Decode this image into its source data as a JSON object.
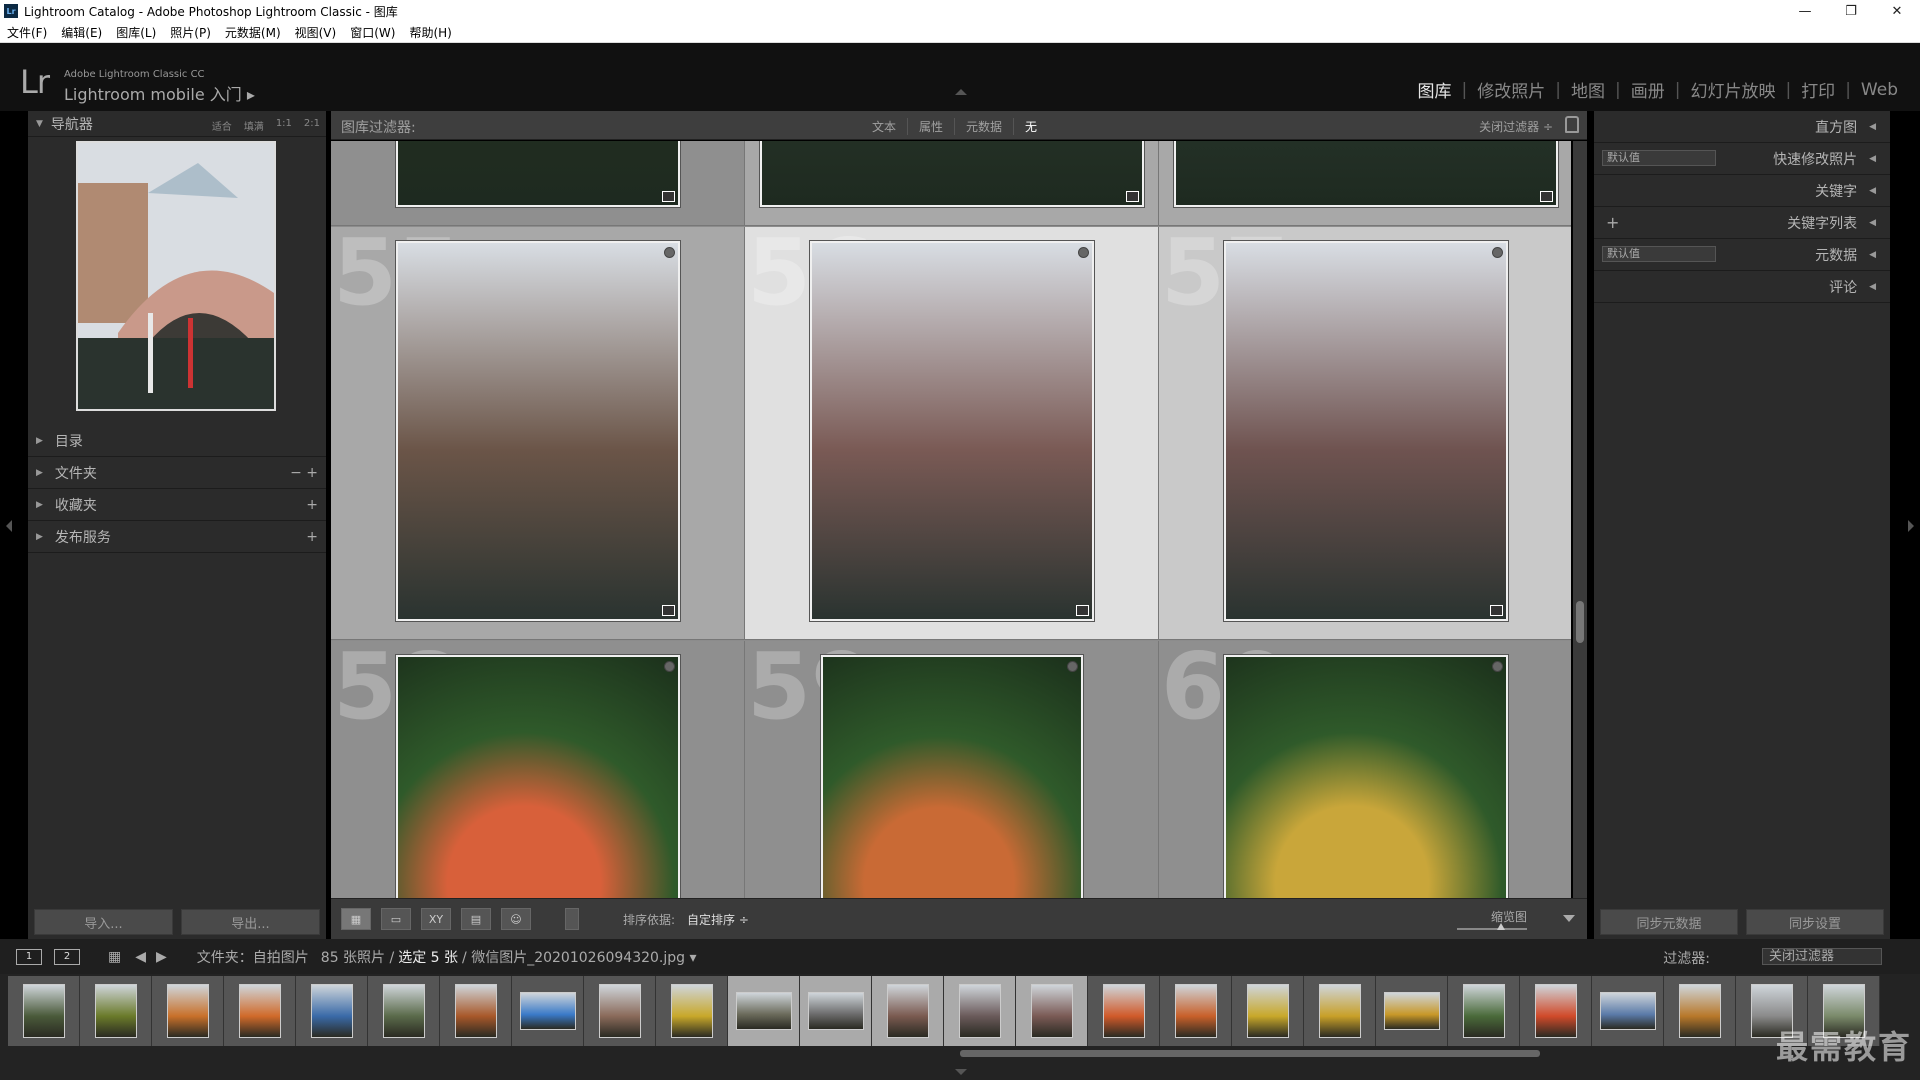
{
  "window": {
    "title": "Lightroom Catalog - Adobe Photoshop Lightroom Classic - 图库",
    "app_icon": "Lr",
    "controls": [
      "—",
      "❐",
      "✕"
    ]
  },
  "menu": [
    "文件(F)",
    "编辑(E)",
    "图库(L)",
    "照片(P)",
    "元数据(M)",
    "视图(V)",
    "窗口(W)",
    "帮助(H)"
  ],
  "identity": {
    "logo": "Lr",
    "product": "Adobe Lightroom Classic CC",
    "mobile": "Lightroom mobile 入门 ▸"
  },
  "modules": [
    {
      "label": "图库",
      "active": true
    },
    {
      "label": "修改照片"
    },
    {
      "label": "地图"
    },
    {
      "label": "画册"
    },
    {
      "label": "幻灯片放映"
    },
    {
      "label": "打印"
    },
    {
      "label": "Web"
    }
  ],
  "left": {
    "navigator": {
      "title": "导航器",
      "options": [
        "适合",
        "填满",
        "1:1",
        "2:1"
      ]
    },
    "panels": [
      {
        "label": "目录",
        "actions": ""
      },
      {
        "label": "文件夹",
        "actions": "− +"
      },
      {
        "label": "收藏夹",
        "actions": "+"
      },
      {
        "label": "发布服务",
        "actions": "+"
      }
    ],
    "import_label": "导入...",
    "export_label": "导出..."
  },
  "filter": {
    "label": "图库过滤器:",
    "tabs": [
      "文本",
      "属性",
      "元数据",
      "无"
    ],
    "right": "关闭过滤器 ÷"
  },
  "grid": {
    "cells": [
      {
        "idx": "",
        "state": "dark",
        "color": "#2c3a1e"
      },
      {
        "idx": "",
        "state": "normal",
        "color": "#3a4a3a"
      },
      {
        "idx": "",
        "state": "normal",
        "color": "#3d4e44"
      },
      {
        "idx": "55",
        "state": "normal",
        "color": "#6b5548"
      },
      {
        "idx": "56",
        "state": "sel-main",
        "color": "#7a5a55"
      },
      {
        "idx": "57",
        "state": "sel",
        "color": "#6f5350"
      },
      {
        "idx": "58",
        "state": "dark",
        "color": "#d8603a"
      },
      {
        "idx": "59",
        "state": "dark",
        "color": "#c96a35"
      },
      {
        "idx": "60",
        "state": "dark",
        "color": "#c9a63a"
      }
    ]
  },
  "toolbar": {
    "sort_label": "排序依据:",
    "sort_value": "自定排序 ÷",
    "zoom_label": "缩览图",
    "view_icons": [
      "▦",
      "▭",
      "XY",
      "▤",
      "☺"
    ]
  },
  "right": {
    "panels": [
      {
        "label": "直方图",
        "left": "",
        "select": ""
      },
      {
        "label": "快速修改照片",
        "left": "",
        "select": "默认值"
      },
      {
        "label": "关键字",
        "left": "",
        "select": ""
      },
      {
        "label": "关键字列表",
        "left": "+",
        "select": ""
      },
      {
        "label": "元数据",
        "left": "",
        "select": "默认值"
      },
      {
        "label": "评论",
        "left": "",
        "select": ""
      }
    ],
    "sync_meta": "同步元数据",
    "sync_settings": "同步设置"
  },
  "filmbar": {
    "screen1": "1",
    "screen2": "2",
    "path_prefix": "文件夹：自拍图片",
    "count": "85 张照片 /",
    "selected": "选定 5 张",
    "file": "/ 微信图片_20201026094320.jpg ▾",
    "filter_label": "过滤器:",
    "filter_value": "关闭过滤器"
  },
  "filmstrip": {
    "thumbs": [
      {
        "color": "#4a5a3a",
        "sel": false,
        "land": false
      },
      {
        "color": "#6a7a2a",
        "sel": false,
        "land": false
      },
      {
        "color": "#c8702a",
        "sel": false,
        "land": false
      },
      {
        "color": "#d06a2a",
        "sel": false,
        "land": false
      },
      {
        "color": "#3a6aa8",
        "sel": false,
        "land": false
      },
      {
        "color": "#5a6a4a",
        "sel": false,
        "land": false
      },
      {
        "color": "#a8582a",
        "sel": false,
        "land": false
      },
      {
        "color": "#3a7ac8",
        "sel": false,
        "land": true
      },
      {
        "color": "#8a6a5a",
        "sel": false,
        "land": false
      },
      {
        "color": "#c8a82a",
        "sel": false,
        "land": false
      },
      {
        "color": "#6a6a5a",
        "sel": true,
        "land": true
      },
      {
        "color": "#6a6a6a",
        "sel": true,
        "land": true
      },
      {
        "color": "#7a5a50",
        "sel": true,
        "land": false
      },
      {
        "color": "#6a5a5a",
        "sel": true,
        "land": false
      },
      {
        "color": "#7a5a55",
        "sel": true,
        "land": false
      },
      {
        "color": "#d05a2a",
        "sel": false,
        "land": false
      },
      {
        "color": "#c8602a",
        "sel": false,
        "land": false
      },
      {
        "color": "#c8a82a",
        "sel": false,
        "land": false
      },
      {
        "color": "#c8a028",
        "sel": false,
        "land": false
      },
      {
        "color": "#c89828",
        "sel": false,
        "land": true
      },
      {
        "color": "#4a6a3a",
        "sel": false,
        "land": false
      },
      {
        "color": "#d04a2a",
        "sel": false,
        "land": false
      },
      {
        "color": "#5a7aa8",
        "sel": false,
        "land": true
      },
      {
        "color": "#b8782a",
        "sel": false,
        "land": false
      },
      {
        "color": "#8a8a8a",
        "sel": false,
        "land": false
      },
      {
        "color": "#7a8a6a",
        "sel": false,
        "land": false
      }
    ]
  },
  "watermark": "最需教育"
}
